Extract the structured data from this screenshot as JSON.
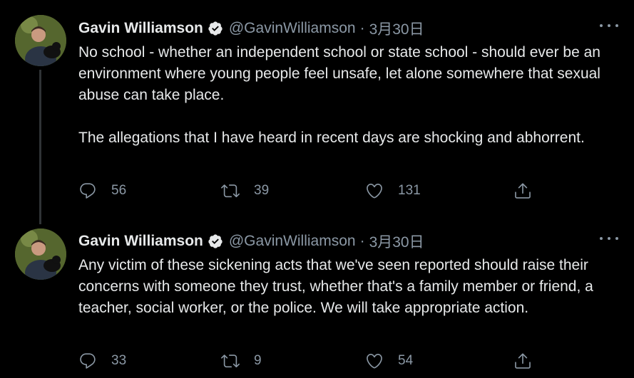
{
  "tweets": [
    {
      "author_name": "Gavin Williamson",
      "handle": "@GavinWilliamson",
      "separator": "·",
      "date": "3月30日",
      "paragraphs": [
        "No school - whether an independent school or state school - should ever be an environment where young people feel unsafe, let alone somewhere that sexual abuse can take place.",
        "The allegations that I have heard in recent days are shocking and abhorrent."
      ],
      "reply_count": "56",
      "retweet_count": "39",
      "like_count": "131"
    },
    {
      "author_name": "Gavin Williamson",
      "handle": "@GavinWilliamson",
      "separator": "·",
      "date": "3月30日",
      "paragraphs": [
        "Any victim of these sickening acts that we've seen reported should raise their concerns with someone they trust, whether that's a family member or friend, a teacher, social worker, or the police. We will take appropriate action."
      ],
      "reply_count": "33",
      "retweet_count": "9",
      "like_count": "54"
    }
  ],
  "icons": {
    "verified": "verified-badge-icon",
    "more": "more-options-icon",
    "reply": "reply-icon",
    "retweet": "retweet-icon",
    "like": "heart-icon",
    "share": "share-icon"
  },
  "colors": {
    "background": "#000000",
    "text": "#e7e9ea",
    "secondary": "#8b98a5",
    "thread_line": "#2f3336"
  }
}
